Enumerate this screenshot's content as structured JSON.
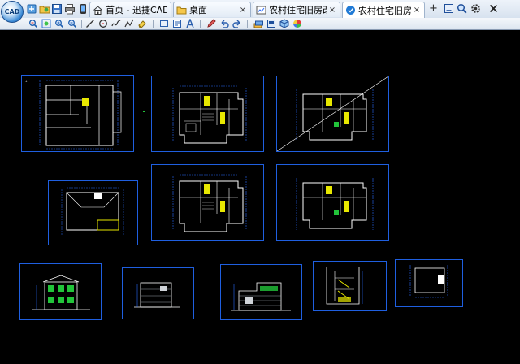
{
  "app": {
    "logo_text": "CAD"
  },
  "quick_buttons": [
    {
      "name": "open-icon"
    },
    {
      "name": "open-folder-icon"
    },
    {
      "name": "save-icon"
    },
    {
      "name": "print-icon"
    },
    {
      "name": "mobile-icon"
    }
  ],
  "tabs": [
    {
      "label": "首页 - 迅捷CAD看图",
      "icon": "home-icon",
      "closable": false,
      "active": false
    },
    {
      "label": "桌面",
      "icon": "folder-icon",
      "closable": true,
      "active": false
    },
    {
      "label": "农村住宅旧房改造...",
      "icon": "drawing-icon",
      "closable": true,
      "active": false
    },
    {
      "label": "农村住宅旧房改造...",
      "icon": "drawing-icon",
      "closable": true,
      "active": true
    }
  ],
  "tab_close_glyph": "×",
  "new_tab_glyph": "+",
  "window_buttons": [
    {
      "name": "minimize-icon"
    },
    {
      "name": "search-icon"
    },
    {
      "name": "settings-icon"
    },
    {
      "name": "close-icon"
    }
  ],
  "toolbar": [
    "zoom-window-icon",
    "zoom-extents-icon",
    "zoom-in-icon",
    "zoom-out-icon",
    "line-icon",
    "circle-icon",
    "spline-icon",
    "polyline-icon",
    "eraser-icon",
    "rectangle-icon",
    "text-frame-icon",
    "text-icon",
    "pen-icon",
    "undo-icon",
    "redo-icon",
    "layers-icon",
    "print-window-icon",
    "3d-box-icon",
    "color-wheel-icon"
  ],
  "colors": {
    "canvas": "#000000",
    "sheet_border": "#1f5fe0",
    "cad_wall": "#ffffff",
    "cad_dim": "#2a6cff",
    "cad_highlight": "#e8e800",
    "cad_green": "#22c43a"
  }
}
